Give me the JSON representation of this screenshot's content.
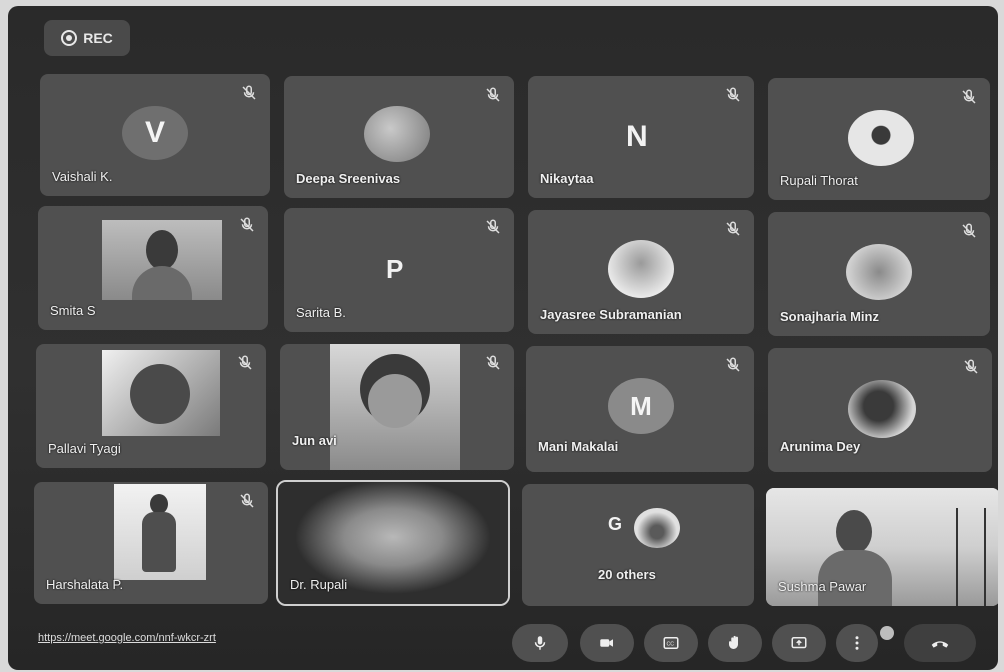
{
  "rec": {
    "label": "REC"
  },
  "participants": [
    {
      "name": "Vaishali K.",
      "initial": "V"
    },
    {
      "name": "Deepa Sreenivas"
    },
    {
      "name": "Nikaytaa",
      "initial": "N"
    },
    {
      "name": "Rupali Thorat"
    },
    {
      "name": "Smita S"
    },
    {
      "name": "Sarita B.",
      "initial": "P"
    },
    {
      "name": "Jayasree Subramanian"
    },
    {
      "name": "Sonajharia Minz"
    },
    {
      "name": "Pallavi Tyagi"
    },
    {
      "name": "Jun   avi"
    },
    {
      "name": "Mani Makalai",
      "initial": "M"
    },
    {
      "name": "Arunima Dey"
    },
    {
      "name": "Harshalata P."
    },
    {
      "name": "Dr. Rupali"
    },
    {
      "name": "20 others",
      "initial": "G"
    },
    {
      "name": "Sushma Pawar"
    }
  ],
  "meeting_link": "https://meet.google.com/nnf-wkcr-zrt",
  "controls": [
    {
      "name": "mic",
      "icon": "mic-icon"
    },
    {
      "name": "camera",
      "icon": "camera-icon"
    },
    {
      "name": "captions",
      "icon": "captions-icon"
    },
    {
      "name": "raise-hand",
      "icon": "hand-icon"
    },
    {
      "name": "present",
      "icon": "present-icon"
    },
    {
      "name": "more",
      "icon": "more-vert-icon"
    },
    {
      "name": "leave",
      "icon": "end-call-icon"
    }
  ],
  "colors": {
    "tile": "#505050",
    "background": "#2d2d2d",
    "text": "#f0f0f0"
  }
}
